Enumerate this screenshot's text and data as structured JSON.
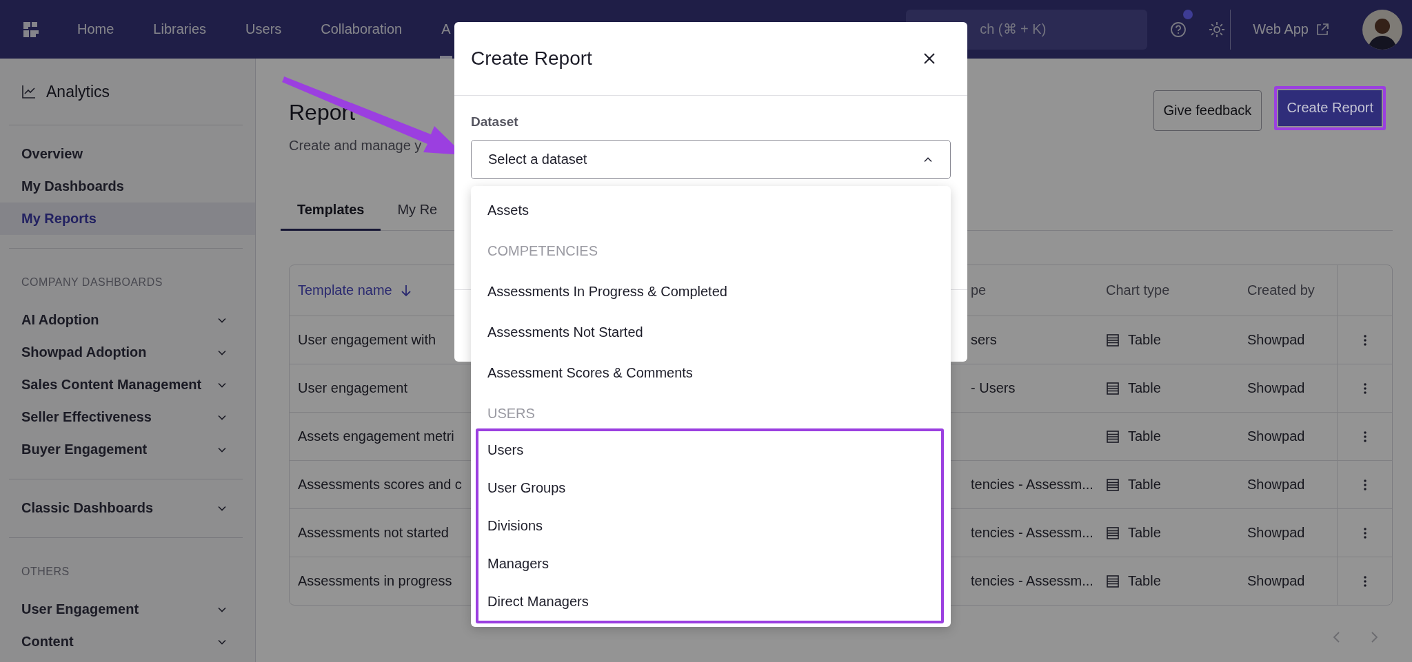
{
  "nav": {
    "items": [
      {
        "label": "Home",
        "selected": false
      },
      {
        "label": "Libraries",
        "selected": false
      },
      {
        "label": "Users",
        "selected": false
      },
      {
        "label": "Collaboration",
        "selected": false
      },
      {
        "label": "A",
        "selected": true
      }
    ],
    "search": {
      "placeholder": "ch (⌘ + K)"
    },
    "help_badge": true,
    "web_app": "Web App"
  },
  "sidebar": {
    "title": "Analytics",
    "sections": [
      {
        "items": [
          {
            "label": "Overview",
            "selected": false
          },
          {
            "label": "My Dashboards",
            "selected": false
          },
          {
            "label": "My Reports",
            "selected": true
          }
        ]
      },
      {
        "heading": "COMPANY DASHBOARDS",
        "items": [
          {
            "label": "AI Adoption",
            "selected": false,
            "expanded": false
          },
          {
            "label": "Showpad Adoption",
            "selected": false,
            "expanded": false
          },
          {
            "label": "Sales Content Management",
            "selected": false,
            "expanded": false
          },
          {
            "label": "Seller Effectiveness",
            "selected": false,
            "expanded": false
          },
          {
            "label": "Buyer Engagement",
            "selected": false,
            "expanded": false
          }
        ]
      },
      {
        "items": [
          {
            "label": "Classic Dashboards",
            "selected": false,
            "expanded": false
          }
        ]
      },
      {
        "heading": "OTHERS",
        "items": [
          {
            "label": "User Engagement",
            "selected": false,
            "expanded": false
          },
          {
            "label": "Content",
            "selected": false,
            "expanded": false
          }
        ]
      }
    ]
  },
  "page": {
    "title": "Report",
    "subtitle": "Create and manage y",
    "actions": [
      {
        "label": "Give feedback",
        "kind": "secondary",
        "highlighted": false
      },
      {
        "label": "Create Report",
        "kind": "primary",
        "highlighted": true
      }
    ],
    "tabs": [
      {
        "label": "Templates",
        "selected": true
      },
      {
        "label": "My Re",
        "selected": false
      }
    ],
    "table": {
      "columns": [
        {
          "label": "Template name",
          "sorted": true
        },
        {
          "label": "pe",
          "sorted": false
        },
        {
          "label": "Chart type",
          "sorted": false
        },
        {
          "label": "Created by",
          "sorted": false
        }
      ],
      "rows": [
        {
          "name": "User engagement with",
          "dataset": "sers",
          "chart_type": "Table",
          "created_by": "Showpad"
        },
        {
          "name": "User engagement",
          "dataset": "- Users",
          "chart_type": "Table",
          "created_by": "Showpad"
        },
        {
          "name": "Assets engagement metri",
          "chart_type": "Table",
          "created_by": "Showpad"
        },
        {
          "name": "Assessments scores and c",
          "dataset": "tencies - Assessm...",
          "chart_type": "Table",
          "created_by": "Showpad"
        },
        {
          "name": "Assessments not started",
          "dataset": "tencies - Assessm...",
          "chart_type": "Table",
          "created_by": "Showpad"
        },
        {
          "name": "Assessments in progress",
          "dataset": "tencies - Assessm...",
          "chart_type": "Table",
          "created_by": "Showpad"
        }
      ]
    },
    "pagination": {
      "previous_disabled": true,
      "next_disabled": true
    }
  },
  "modal": {
    "title": "Create Report",
    "field_label": "Dataset",
    "select": {
      "placeholder": "Select a dataset",
      "expanded": true
    },
    "dropdown": {
      "groups": [
        {
          "highlighted": false,
          "items": [
            "Assets"
          ]
        },
        {
          "heading": "COMPETENCIES",
          "highlighted": false,
          "items": [
            "Assessments In Progress & Completed",
            "Assessments Not Started",
            "Assessment Scores & Comments"
          ]
        },
        {
          "heading": "USERS",
          "highlighted": true,
          "items": [
            "Users",
            "User Groups",
            "Divisions",
            "Managers",
            "Direct Managers"
          ]
        }
      ]
    }
  },
  "arrow_annotation": true
}
